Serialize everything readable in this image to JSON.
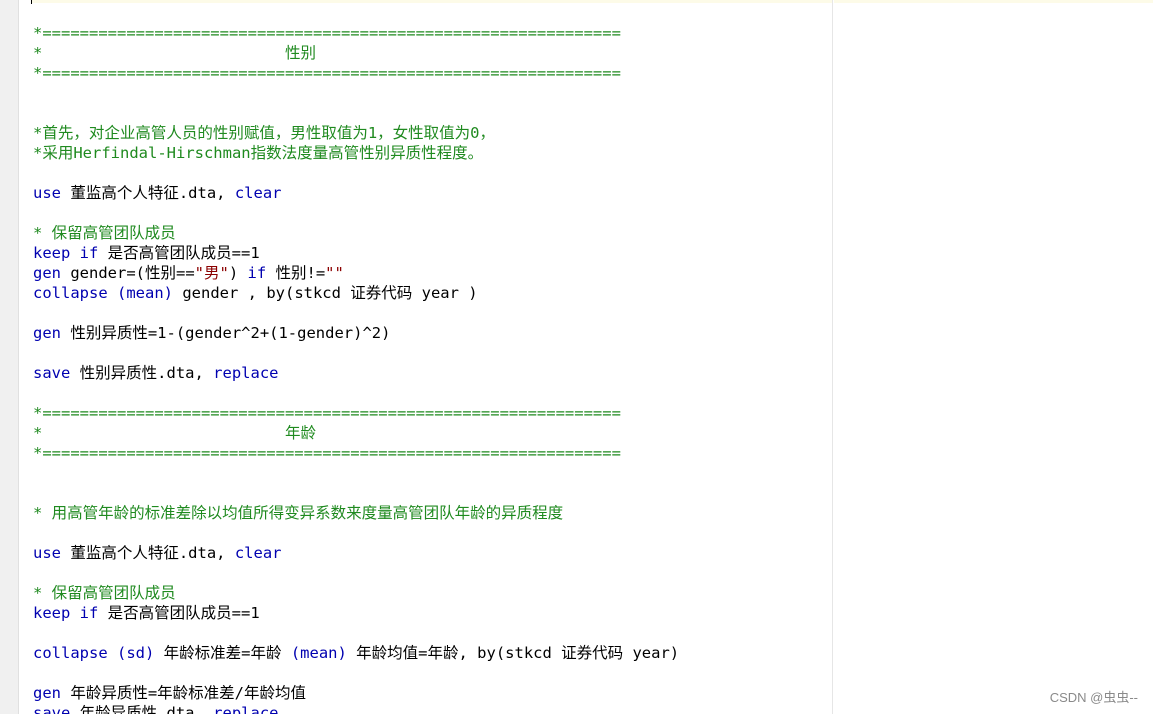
{
  "watermark": "CSDN @虫虫--",
  "code": {
    "l1": "*==============================================================",
    "l2": "*                          性别",
    "l3": "*==============================================================",
    "l4": "*首先，对企业高管人员的性别赋值，男性取值为1，女性取值为0，",
    "l5": "*采用Herfindal-Hirschman指数法度量高管性别异质性程度。",
    "use": "use",
    "dta1": " 董监高个人特征.dta, ",
    "clear": "clear",
    "comment_keep": "* 保留高管团队成员",
    "keep": "keep",
    "if": " if",
    "keep_cond": " 是否高管团队成员==1",
    "gen": "gen",
    "gen_gender_a": " gender=(性别==",
    "str_male": "\"男\"",
    "gen_gender_b": ") ",
    "gen_gender_c": " 性别!=",
    "str_empty": "\"\"",
    "collapse": "collapse",
    "mean": "(mean)",
    "collapse1_rest": " gender , by(stkcd 证券代码 year )",
    "gen_hetero": " 性别异质性=1-(gender^2+(1-gender)^2)",
    "save": "save",
    "save1_file": " 性别异质性.dta, ",
    "replace": "replace",
    "l17": "*==============================================================",
    "l18": "*                          年龄",
    "l19": "*==============================================================",
    "l22": "* 用高管年龄的标准差除以均值所得变异系数来度量高管团队年龄的异质程度",
    "sd": "(sd)",
    "collapse2_a": " 年龄标准差=年龄 ",
    "collapse2_b": " 年龄均值=年龄, by(stkcd 证券代码 year)",
    "gen_age": " 年龄异质性=年龄标准差/年龄均值",
    "save2_file": " 年龄异质性.dta, "
  }
}
